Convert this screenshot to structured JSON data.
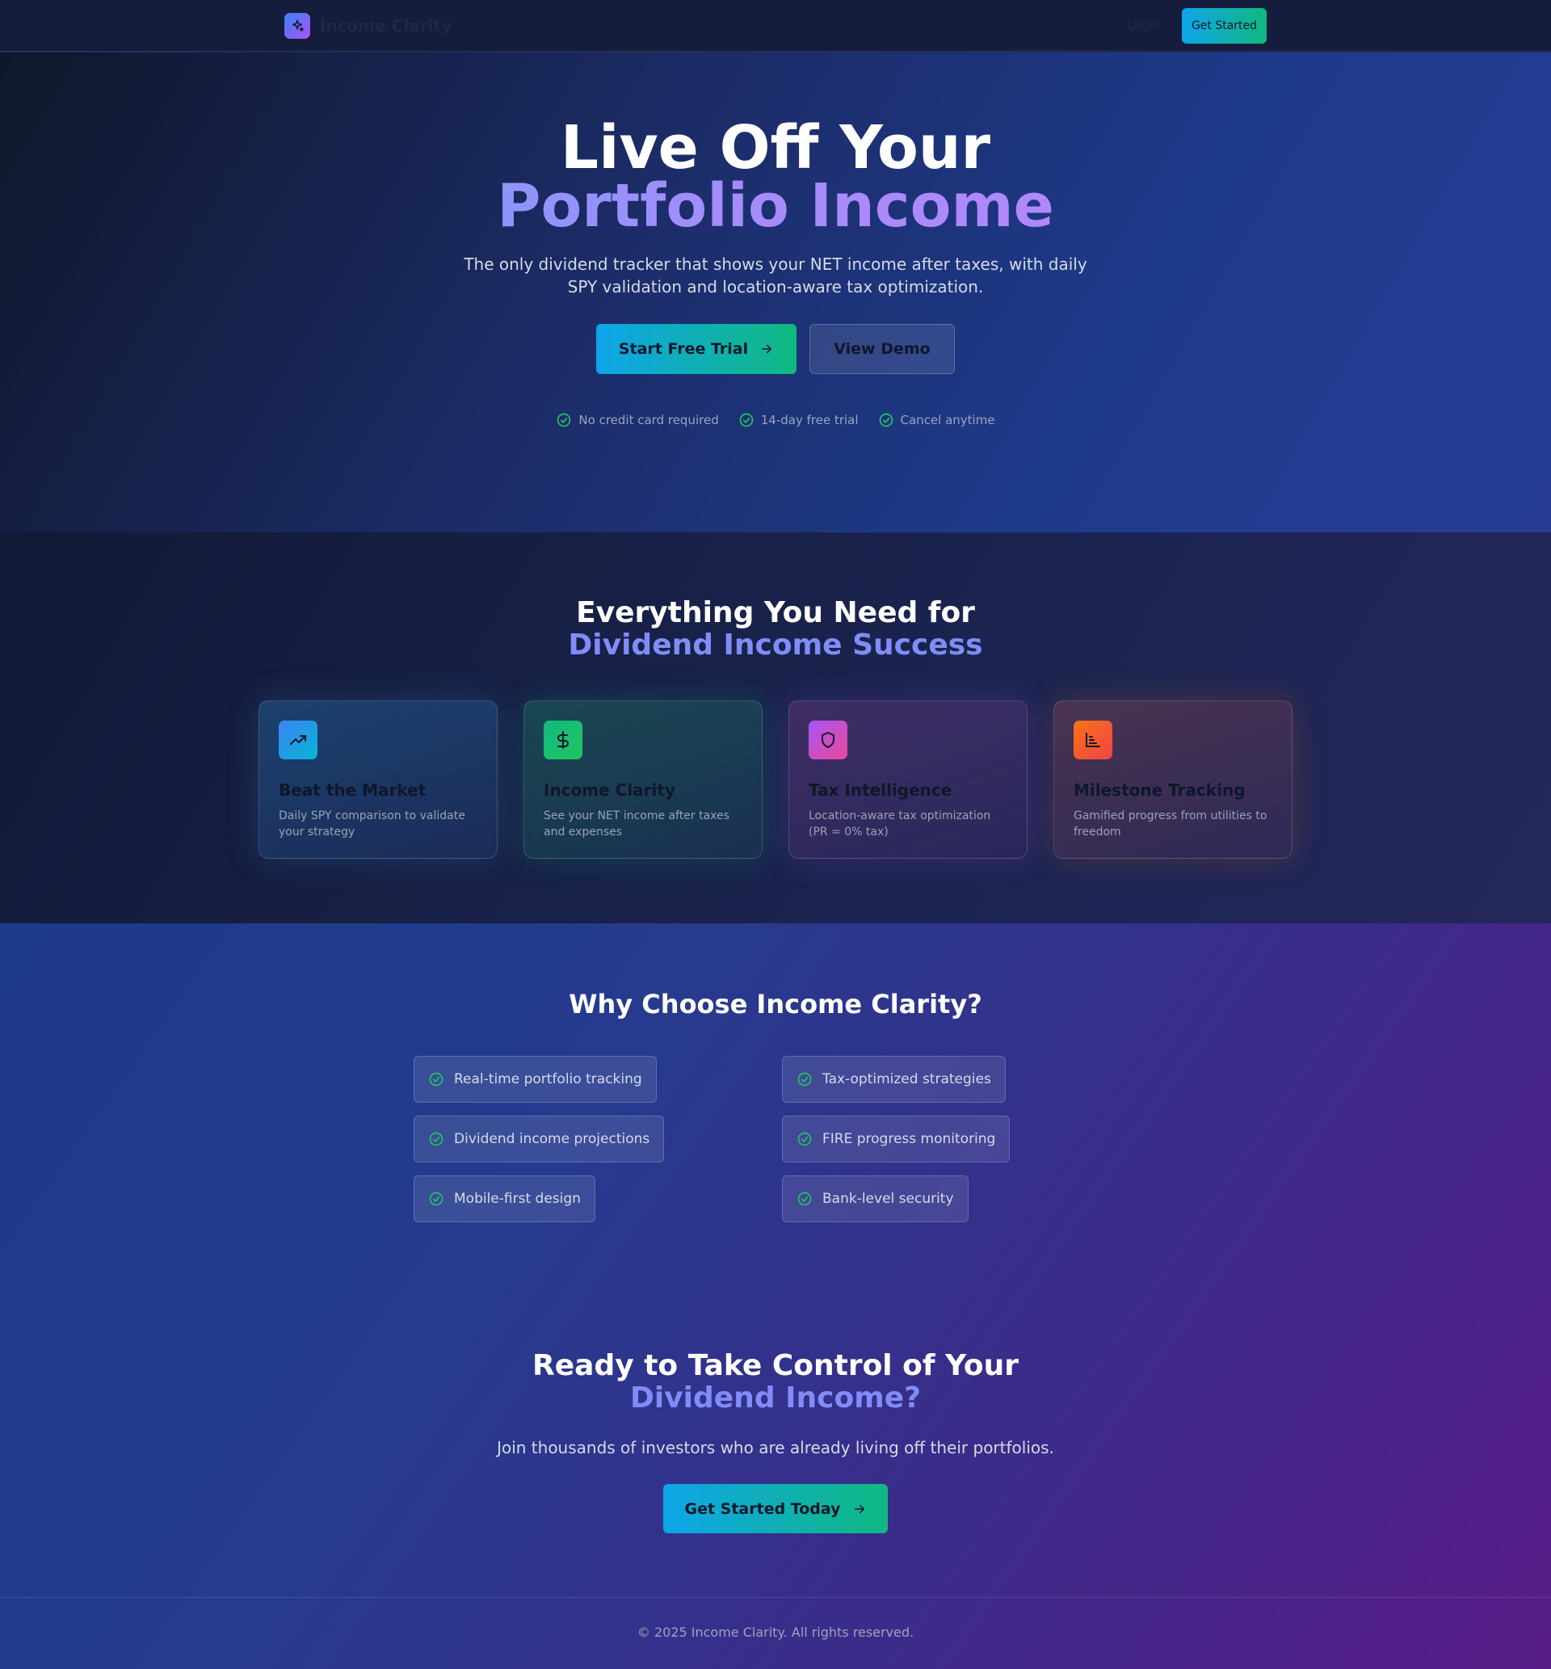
{
  "nav": {
    "brand": "Income Clarity",
    "login": "Login",
    "cta": "Get Started"
  },
  "hero": {
    "title_line1": "Live Off Your",
    "title_line2": "Portfolio Income",
    "subtitle": "The only dividend tracker that shows your NET income after taxes, with daily SPY validation and location-aware tax optimization.",
    "primary_button": "Start Free Trial",
    "secondary_button": "View Demo",
    "trust": [
      "No credit card required",
      "14-day free trial",
      "Cancel anytime"
    ]
  },
  "features": {
    "title_line1": "Everything You Need for",
    "title_line2": "Dividend Income Success",
    "cards": [
      {
        "title": "Beat the Market",
        "desc": "Daily SPY comparison to validate your strategy",
        "icon": "trending-up-icon"
      },
      {
        "title": "Income Clarity",
        "desc": "See your NET income after taxes and expenses",
        "icon": "dollar-icon"
      },
      {
        "title": "Tax Intelligence",
        "desc": "Location-aware tax optimization (PR = 0% tax)",
        "icon": "shield-icon"
      },
      {
        "title": "Milestone Tracking",
        "desc": "Gamified progress from utilities to freedom",
        "icon": "bar-chart-icon"
      }
    ]
  },
  "why": {
    "title": "Why Choose Income Clarity?",
    "benefits": [
      "Real-time portfolio tracking",
      "Tax-optimized strategies",
      "Dividend income projections",
      "FIRE progress monitoring",
      "Mobile-first design",
      "Bank-level security"
    ]
  },
  "cta": {
    "title_line1": "Ready to Take Control of Your",
    "title_line2": "Dividend Income?",
    "subtitle": "Join thousands of investors who are already living off their portfolios.",
    "button": "Get Started Today"
  },
  "footer": {
    "copyright": "© 2025 Income Clarity. All rights reserved."
  },
  "colors": {
    "accent_blue": "#0ea5e9",
    "accent_green": "#10b981",
    "accent_purple": "#818cf8",
    "check_green": "#22c55e"
  }
}
